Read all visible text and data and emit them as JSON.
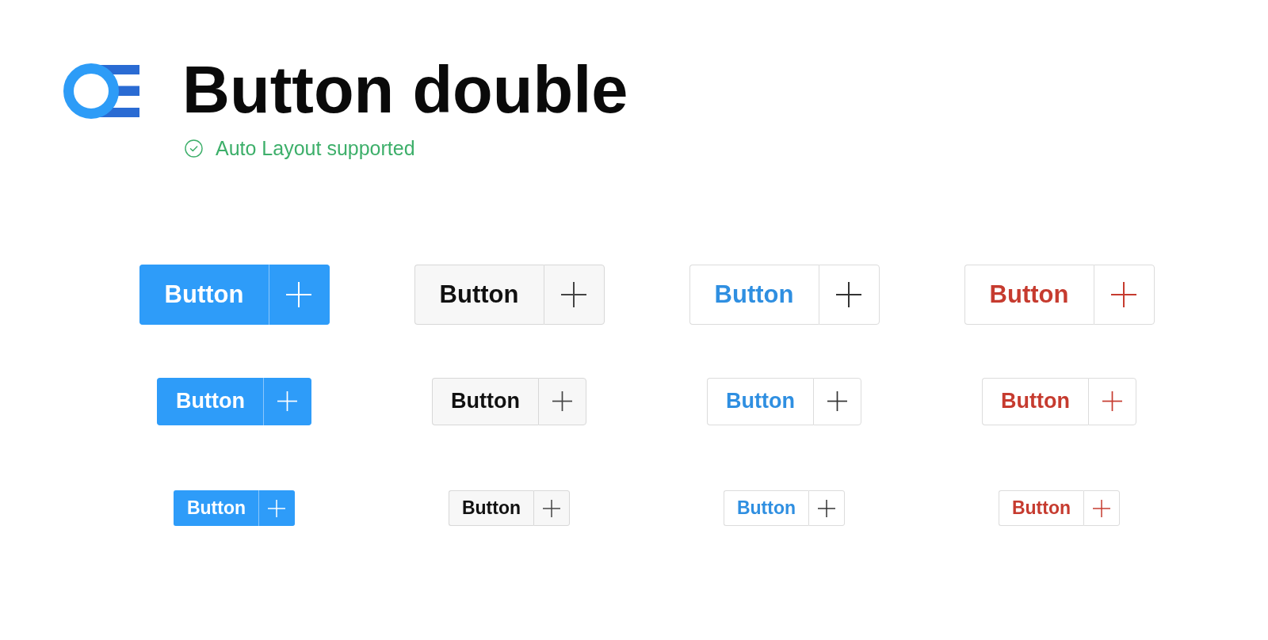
{
  "header": {
    "title": "Button double",
    "subtitle": "Auto Layout supported"
  },
  "button_rows": [
    {
      "kind": "large",
      "buttons": [
        {
          "kind": "primary",
          "label": "Button"
        },
        {
          "kind": "neutral",
          "label": "Button"
        },
        {
          "kind": "blue-outline",
          "label": "Button"
        },
        {
          "kind": "red-outline",
          "label": "Button"
        }
      ]
    },
    {
      "kind": "medium",
      "buttons": [
        {
          "kind": "primary",
          "label": "Button"
        },
        {
          "kind": "neutral",
          "label": "Button"
        },
        {
          "kind": "blue-outline",
          "label": "Button"
        },
        {
          "kind": "red-outline",
          "label": "Button"
        }
      ]
    },
    {
      "kind": "small",
      "buttons": [
        {
          "kind": "primary",
          "label": "Button"
        },
        {
          "kind": "neutral",
          "label": "Button"
        },
        {
          "kind": "blue-outline",
          "label": "Button"
        },
        {
          "kind": "red-outline",
          "label": "Button"
        }
      ]
    }
  ]
}
